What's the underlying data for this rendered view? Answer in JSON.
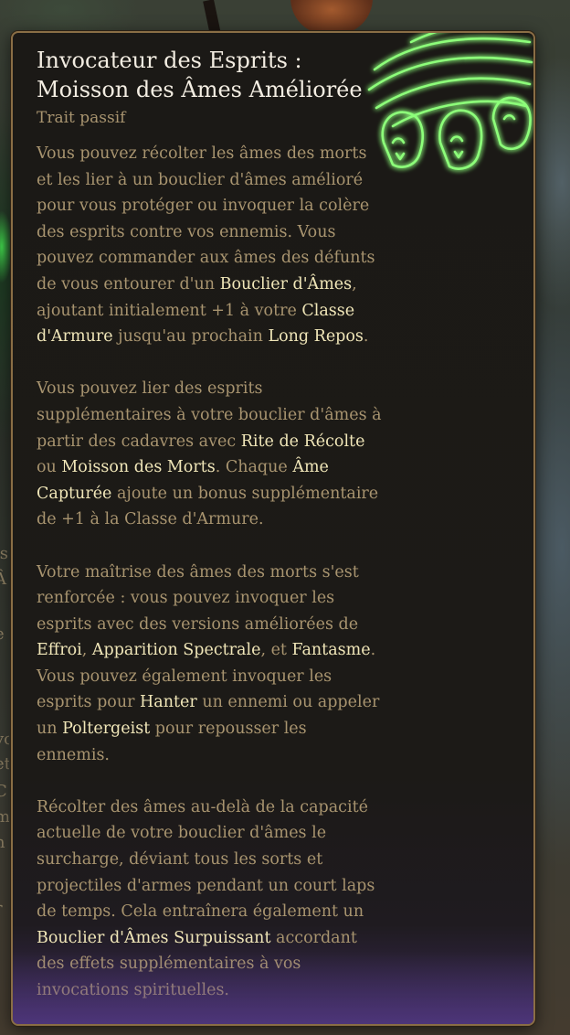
{
  "tooltip": {
    "title_line1": "Invocateur des Esprits :",
    "title_line2": "Moisson des Âmes Améliorée",
    "subtitle": "Trait passif",
    "icon": "soul-harvest-hands-icon",
    "paragraphs": [
      [
        {
          "text": "Vous pouvez récolter les âmes des morts et les lier à un bouclier d'âmes amélioré pour vous protéger ou invoquer la colère des esprits contre vos ennemis. Vous pouvez commander aux âmes des défunts de vous entourer d'un ",
          "hl": false
        },
        {
          "text": "Bouclier d'Âmes",
          "hl": true
        },
        {
          "text": ", ajoutant initialement +1 à votre ",
          "hl": false
        },
        {
          "text": "Classe d'Armure",
          "hl": true
        },
        {
          "text": " jusqu'au prochain ",
          "hl": false
        },
        {
          "text": "Long Repos",
          "hl": true
        },
        {
          "text": ".",
          "hl": false
        }
      ],
      [
        {
          "text": "Vous pouvez lier des esprits supplémentaires à votre bouclier d'âmes à partir des cadavres avec ",
          "hl": false
        },
        {
          "text": "Rite de Récolte",
          "hl": true
        },
        {
          "text": " ou ",
          "hl": false
        },
        {
          "text": "Moisson des Morts",
          "hl": true
        },
        {
          "text": ". Chaque ",
          "hl": false
        },
        {
          "text": "Âme Capturée",
          "hl": true
        },
        {
          "text": " ajoute un bonus supplémentaire de +1 à la Classe d'Armure.",
          "hl": false
        }
      ],
      [
        {
          "text": "Votre maîtrise des âmes des morts s'est renforcée : vous pouvez invoquer les esprits avec des versions améliorées de ",
          "hl": false
        },
        {
          "text": "Effroi",
          "hl": true
        },
        {
          "text": ", ",
          "hl": false
        },
        {
          "text": "Apparition Spectrale",
          "hl": true
        },
        {
          "text": ", et ",
          "hl": false
        },
        {
          "text": "Fantasme",
          "hl": true
        },
        {
          "text": ". Vous pouvez également invoquer les esprits pour ",
          "hl": false
        },
        {
          "text": "Hanter",
          "hl": true
        },
        {
          "text": " un ennemi ou appeler un ",
          "hl": false
        },
        {
          "text": "Poltergeist",
          "hl": true
        },
        {
          "text": " pour repousser les ennemis.",
          "hl": false
        }
      ],
      [
        {
          "text": "Récolter des âmes au-delà de la capacité actuelle de votre bouclier d'âmes le surcharge, déviant tous les sorts et projectiles d'armes pendant un court laps de temps. Cela entraînera également un ",
          "hl": false
        },
        {
          "text": "Bouclier d'Âmes Surpuissant",
          "hl": true
        },
        {
          "text": " accordant des effets supplémentaires à vos invocations spirituelles.",
          "hl": false
        }
      ]
    ]
  },
  "background": {
    "left_fragments": [
      "is",
      "Â",
      "e",
      "vo",
      "et",
      "C",
      "m",
      "n",
      "r"
    ]
  },
  "colors": {
    "title": "#f3ede2",
    "body": "#a8946f",
    "highlight": "#f0e6b8",
    "border": "#8a6e45",
    "glow": "#5cff5c"
  }
}
